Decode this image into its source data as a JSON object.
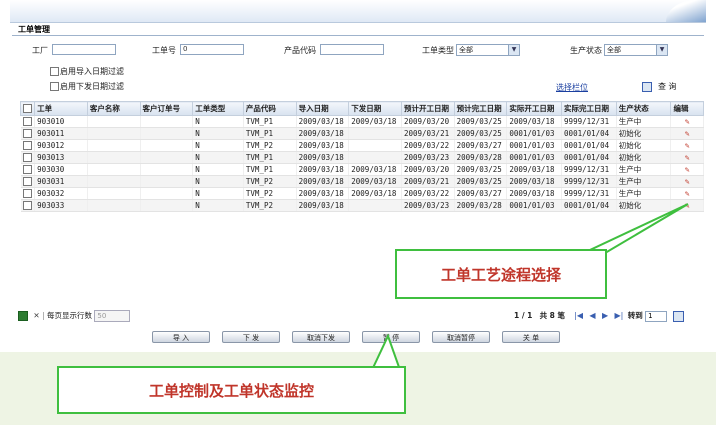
{
  "page": {
    "title": "工单管理"
  },
  "filters": {
    "factory_label": "工厂",
    "factory_value": "",
    "order_no_label": "工单号",
    "order_no_value": "0",
    "product_code_label": "产品代码",
    "product_code_value": "",
    "order_type_label": "工单类型",
    "order_type_value": "全部",
    "prod_status_label": "生产状态",
    "prod_status_value": "全部",
    "import_date_filter": "启用导入日期过滤",
    "issue_date_filter": "启用下发日期过滤",
    "select_columns_link": "选择栏位",
    "query_label": "查 询"
  },
  "grid": {
    "columns": [
      "工单",
      "客户名称",
      "客户订单号",
      "工单类型",
      "产品代码",
      "导入日期",
      "下发日期",
      "预计开工日期",
      "预计完工日期",
      "实际开工日期",
      "实际完工日期",
      "生产状态",
      "编辑"
    ],
    "rows": [
      [
        "903010",
        "",
        "",
        "N",
        "TVM_P1",
        "2009/03/18",
        "2009/03/18",
        "2009/03/20",
        "2009/03/25",
        "2009/03/18",
        "9999/12/31",
        "生产中"
      ],
      [
        "903011",
        "",
        "",
        "N",
        "TVM_P1",
        "2009/03/18",
        "",
        "2009/03/21",
        "2009/03/25",
        "0001/01/03",
        "0001/01/04",
        "初始化"
      ],
      [
        "903012",
        "",
        "",
        "N",
        "TVM_P2",
        "2009/03/18",
        "",
        "2009/03/22",
        "2009/03/27",
        "0001/01/03",
        "0001/01/04",
        "初始化"
      ],
      [
        "903013",
        "",
        "",
        "N",
        "TVM_P1",
        "2009/03/18",
        "",
        "2009/03/23",
        "2009/03/28",
        "0001/01/03",
        "0001/01/04",
        "初始化"
      ],
      [
        "903030",
        "",
        "",
        "N",
        "TVM_P1",
        "2009/03/18",
        "2009/03/18",
        "2009/03/20",
        "2009/03/25",
        "2009/03/18",
        "9999/12/31",
        "生产中"
      ],
      [
        "903031",
        "",
        "",
        "N",
        "TVM_P2",
        "2009/03/18",
        "2009/03/18",
        "2009/03/21",
        "2009/03/25",
        "2009/03/18",
        "9999/12/31",
        "生产中"
      ],
      [
        "903032",
        "",
        "",
        "N",
        "TVM_P2",
        "2009/03/18",
        "2009/03/18",
        "2009/03/22",
        "2009/03/27",
        "2009/03/18",
        "9999/12/31",
        "生产中"
      ],
      [
        "903033",
        "",
        "",
        "N",
        "TVM_P2",
        "2009/03/18",
        "",
        "2009/03/23",
        "2009/03/28",
        "0001/01/03",
        "0001/01/04",
        "初始化"
      ]
    ]
  },
  "pager": {
    "per_page_label": "每页显示行数",
    "per_page_value": "50",
    "page_info": "1 / 1",
    "total_info": "共 8 笔",
    "goto_label": "转到",
    "goto_value": "1"
  },
  "buttons": {
    "import": "导 入",
    "issue": "下 发",
    "cancel_issue": "取消下发",
    "pause": "暂 停",
    "cancel_pause": "取消暂停",
    "close": "关 单"
  },
  "callouts": {
    "routing": "工单工艺途程选择",
    "control": "工单控制及工单状态监控"
  },
  "colors": {
    "callout_border": "#3fbf3f",
    "callout_text": "#c0352a",
    "background": "#eef4e4"
  }
}
